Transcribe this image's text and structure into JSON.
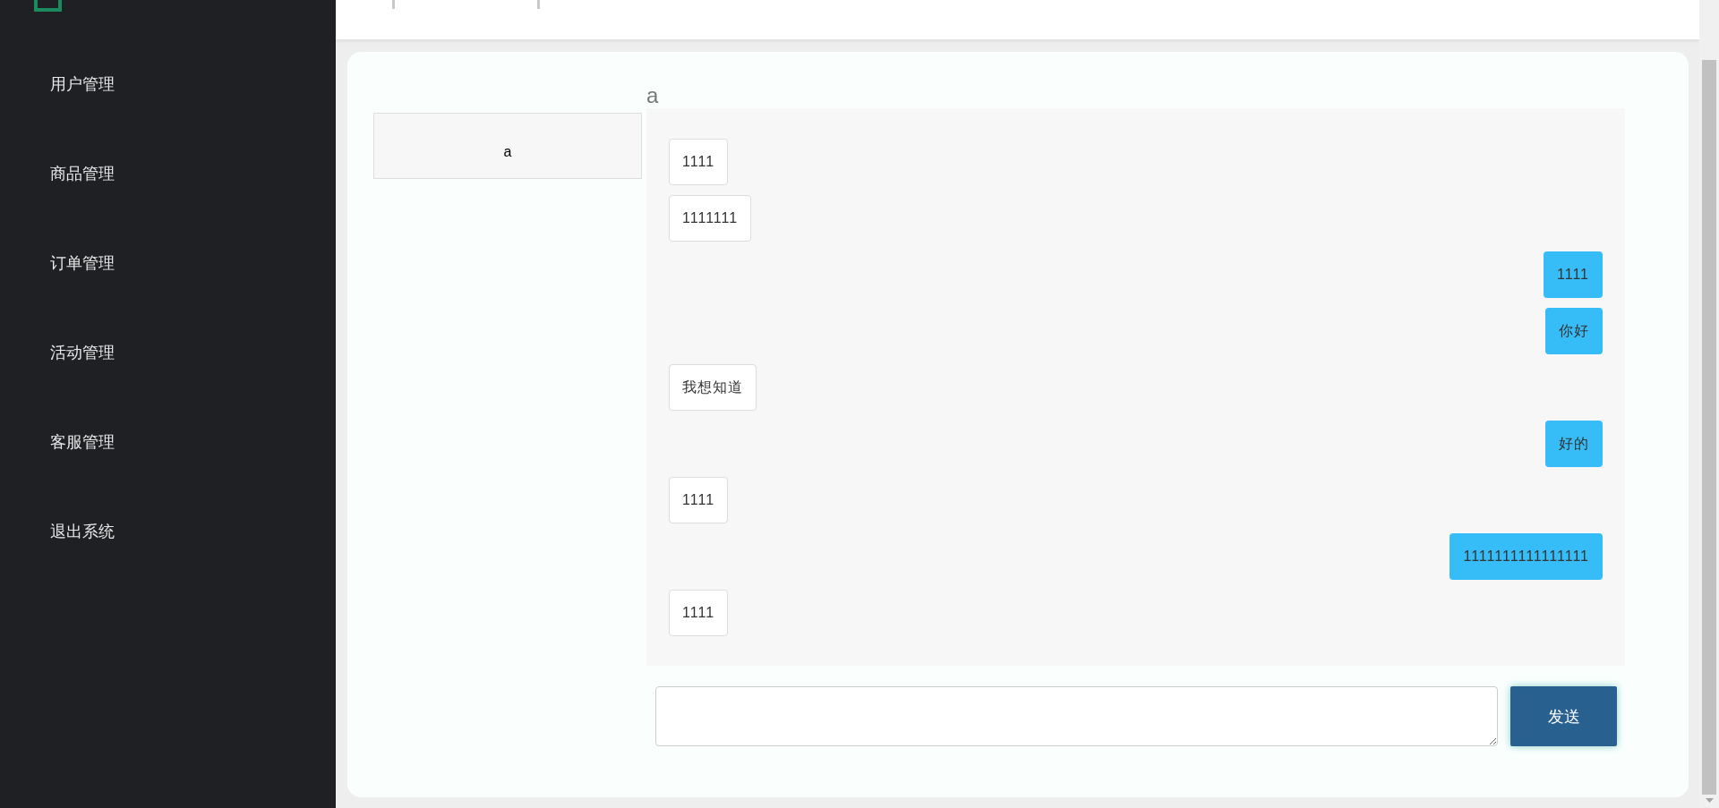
{
  "sidebar": {
    "items": [
      "用户管理",
      "商品管理",
      "订单管理",
      "活动管理",
      "客服管理",
      "退出系统"
    ]
  },
  "chat": {
    "contacts": [
      {
        "name": "a"
      }
    ],
    "title": "a",
    "messages": [
      {
        "kind": "received",
        "text": "1111"
      },
      {
        "kind": "received",
        "text": "1111111"
      },
      {
        "kind": "sent",
        "text": "1111"
      },
      {
        "kind": "sent",
        "text": "你好"
      },
      {
        "kind": "received",
        "text": "我想知道"
      },
      {
        "kind": "sent",
        "text": "好的"
      },
      {
        "kind": "received",
        "text": "1111"
      },
      {
        "kind": "sent",
        "text": "1111111111111111"
      },
      {
        "kind": "received",
        "text": "1111"
      }
    ],
    "send_button": "发送"
  }
}
